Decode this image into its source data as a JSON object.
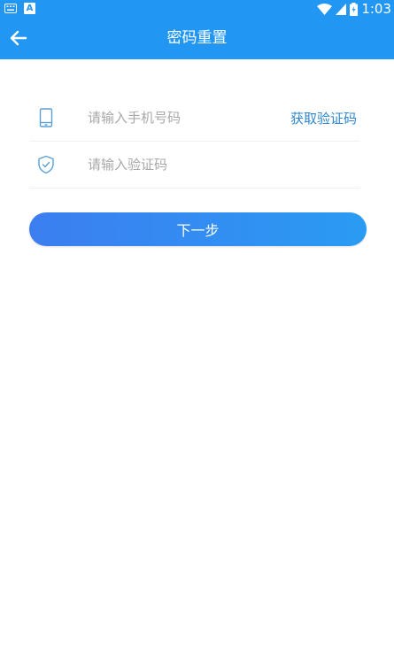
{
  "status_bar": {
    "time": "1:03",
    "icons": [
      "keyboard-icon",
      "a-notification-icon",
      "wifi-icon",
      "signal-icon",
      "battery-icon"
    ]
  },
  "app_bar": {
    "title": "密码重置",
    "back_icon": "arrow-left-icon"
  },
  "form": {
    "phone": {
      "placeholder": "请输入手机号码",
      "value": "",
      "icon": "phone-icon"
    },
    "code": {
      "placeholder": "请输入验证码",
      "value": "",
      "icon": "shield-check-icon",
      "get_code_label": "获取验证码"
    }
  },
  "next_button": {
    "label": "下一步"
  },
  "colors": {
    "primary": "#2196f3",
    "link": "#2f86cf",
    "icon": "#5a9fd6"
  }
}
